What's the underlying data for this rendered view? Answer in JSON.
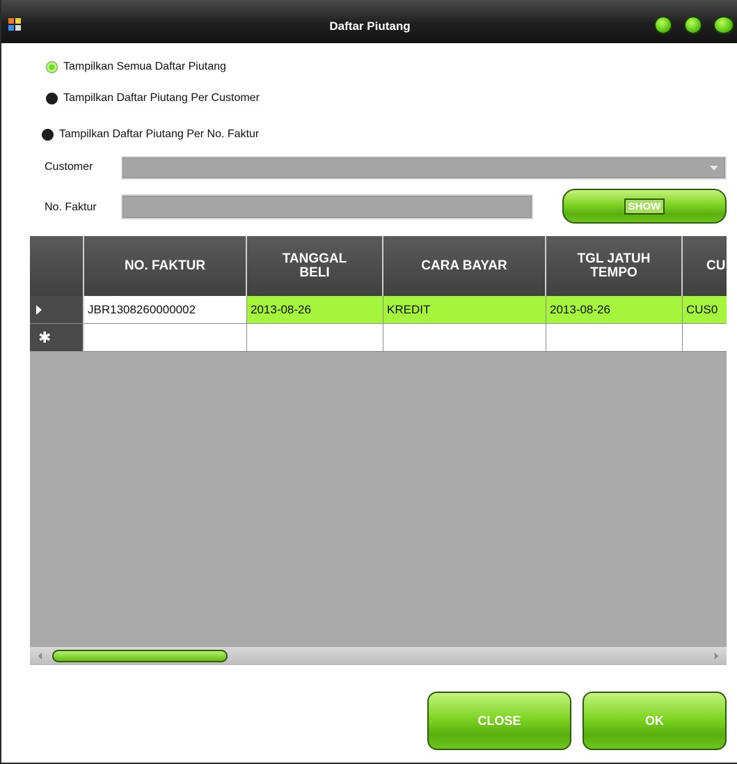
{
  "window": {
    "title": "Daftar Piutang"
  },
  "filters": {
    "radio_all": "Tampilkan Semua Daftar Piutang",
    "radio_customer": "Tampilkan Daftar Piutang Per Customer",
    "radio_faktur": "Tampilkan Daftar Piutang Per No. Faktur",
    "selected": "radio_all"
  },
  "form": {
    "customer_label": "Customer",
    "customer_value": "",
    "faktur_label": "No. Faktur",
    "faktur_value": "",
    "show_button": "SHOW"
  },
  "table": {
    "columns": [
      "NO. FAKTUR",
      "TANGGAL BELI",
      "CARA BAYAR",
      "TGL JATUH TEMPO",
      "CU"
    ],
    "rows": [
      [
        "JBR1308260000002",
        "2013-08-26",
        "KREDIT",
        "2013-08-26",
        "CUS0"
      ]
    ],
    "new_row_marker": "✱",
    "row_highlight_color": "#a5f53c"
  },
  "buttons": {
    "close": "CLOSE",
    "ok": "OK"
  },
  "colors": {
    "accent_green": "#7fd524",
    "titlebar": "#1f1f1f"
  }
}
